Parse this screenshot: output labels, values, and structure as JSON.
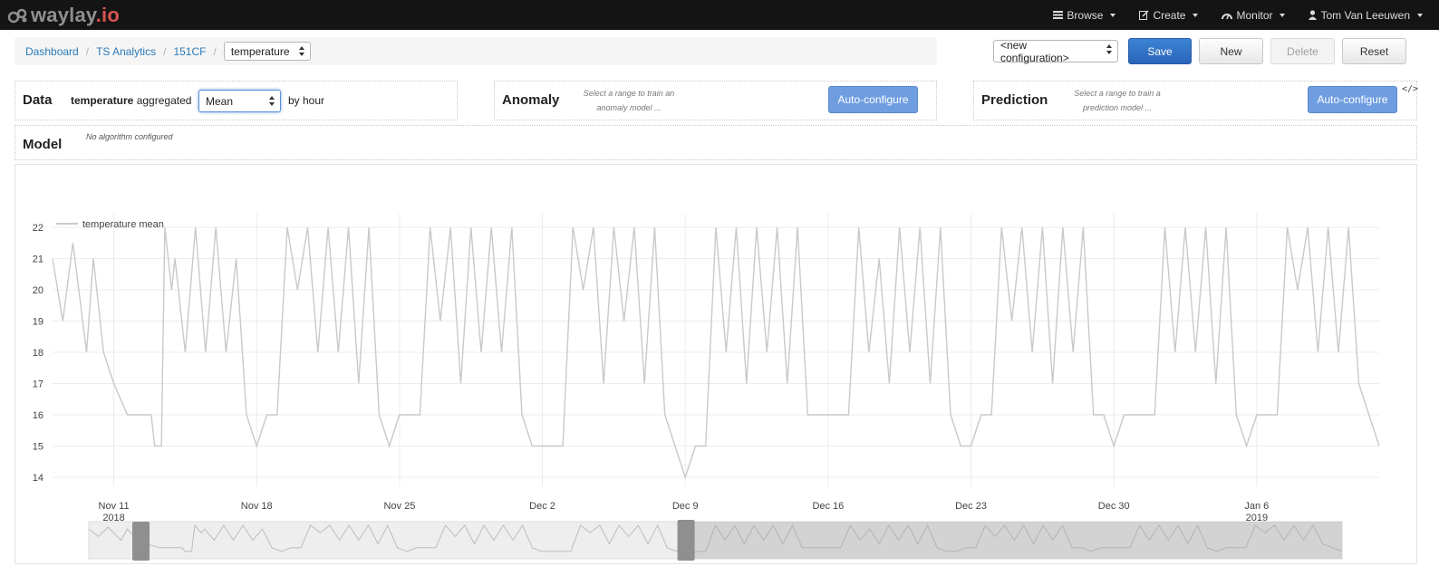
{
  "app": {
    "brand": "waylay",
    "brand_suffix": ".io",
    "nav": [
      {
        "label": "Browse",
        "icon": "list-icon"
      },
      {
        "label": "Create",
        "icon": "edit-icon"
      },
      {
        "label": "Monitor",
        "icon": "dashboard-icon"
      },
      {
        "label": "Tom Van Leeuwen",
        "icon": "user-icon"
      }
    ]
  },
  "breadcrumb": {
    "items": [
      "Dashboard",
      "TS Analytics",
      "151CF"
    ],
    "separator": "/",
    "metric_select": "temperature"
  },
  "toolbar": {
    "config_select": "<new configuration>",
    "save": "Save",
    "new": "New",
    "delete": "Delete",
    "reset": "Reset"
  },
  "data_panel": {
    "title": "Data",
    "metric": "temperature",
    "aggregated_label": "aggregated",
    "aggregation": "Mean",
    "interval": "by hour"
  },
  "anomaly_panel": {
    "title": "Anomaly",
    "hint_line1": "Select a range to train an",
    "hint_line2": "anomaly model ...",
    "button": "Auto-configure"
  },
  "prediction_panel": {
    "title": "Prediction",
    "hint_line1": "Select a range to train a",
    "hint_line2": "prediction model ...",
    "button": "Auto-configure"
  },
  "model_panel": {
    "title": "Model",
    "status": "No algorithm configured"
  },
  "colors": {
    "navbar": "#141414",
    "primary": "#2a64b8",
    "auto_button": "#6e9de0",
    "series": "#c9c9c9",
    "brand_accent": "#d9534f"
  },
  "chart_data": {
    "type": "line",
    "legend_position": "top-left",
    "grid": true,
    "ylim": [
      14,
      22
    ],
    "y_ticks": [
      14,
      15,
      16,
      17,
      18,
      19,
      20,
      21,
      22
    ],
    "x_range": [
      "2018-11-08",
      "2019-01-12"
    ],
    "x_ticks": [
      {
        "label": "Nov 11",
        "year": "2018",
        "date": "2018-11-11"
      },
      {
        "label": "Nov 18",
        "year": "",
        "date": "2018-11-18"
      },
      {
        "label": "Nov 25",
        "year": "",
        "date": "2018-11-25"
      },
      {
        "label": "Dec 2",
        "year": "",
        "date": "2018-12-02"
      },
      {
        "label": "Dec 9",
        "year": "",
        "date": "2018-12-09"
      },
      {
        "label": "Dec 16",
        "year": "",
        "date": "2018-12-16"
      },
      {
        "label": "Dec 23",
        "year": "",
        "date": "2018-12-23"
      },
      {
        "label": "Dec 30",
        "year": "",
        "date": "2018-12-30"
      },
      {
        "label": "Jan 6",
        "year": "2019",
        "date": "2019-01-06"
      }
    ],
    "series": [
      {
        "name": "temperature mean",
        "points": [
          [
            "2018-11-08",
            21
          ],
          [
            "2018-11-08T12",
            19
          ],
          [
            "2018-11-09",
            21.5
          ],
          [
            "2018-11-09T16",
            18
          ],
          [
            "2018-11-10",
            21
          ],
          [
            "2018-11-10T12",
            18
          ],
          [
            "2018-11-11",
            17
          ],
          [
            "2018-11-11T16",
            16
          ],
          [
            "2018-11-12",
            16
          ],
          [
            "2018-11-12T20",
            16
          ],
          [
            "2018-11-13",
            15
          ],
          [
            "2018-11-13T08",
            15
          ],
          [
            "2018-11-13T12",
            22
          ],
          [
            "2018-11-13T20",
            20
          ],
          [
            "2018-11-14",
            21
          ],
          [
            "2018-11-14T12",
            18
          ],
          [
            "2018-11-15",
            22
          ],
          [
            "2018-11-15T12",
            18
          ],
          [
            "2018-11-16",
            22
          ],
          [
            "2018-11-16T12",
            18
          ],
          [
            "2018-11-17",
            21
          ],
          [
            "2018-11-17T12",
            16
          ],
          [
            "2018-11-18",
            15
          ],
          [
            "2018-11-18T12",
            16
          ],
          [
            "2018-11-19",
            16
          ],
          [
            "2018-11-19T12",
            22
          ],
          [
            "2018-11-20",
            20
          ],
          [
            "2018-11-20T12",
            22
          ],
          [
            "2018-11-21",
            18
          ],
          [
            "2018-11-21T12",
            22
          ],
          [
            "2018-11-22",
            18
          ],
          [
            "2018-11-22T12",
            22
          ],
          [
            "2018-11-23",
            17
          ],
          [
            "2018-11-23T12",
            22
          ],
          [
            "2018-11-24",
            16
          ],
          [
            "2018-11-24T12",
            15
          ],
          [
            "2018-11-25",
            16
          ],
          [
            "2018-11-26",
            16
          ],
          [
            "2018-11-26T12",
            22
          ],
          [
            "2018-11-27",
            19
          ],
          [
            "2018-11-27T12",
            22
          ],
          [
            "2018-11-28",
            17
          ],
          [
            "2018-11-28T12",
            22
          ],
          [
            "2018-11-29",
            18
          ],
          [
            "2018-11-29T12",
            22
          ],
          [
            "2018-11-30",
            18
          ],
          [
            "2018-11-30T12",
            22
          ],
          [
            "2018-12-01",
            16
          ],
          [
            "2018-12-01T12",
            15
          ],
          [
            "2018-12-02",
            15
          ],
          [
            "2018-12-03",
            15
          ],
          [
            "2018-12-03T12",
            22
          ],
          [
            "2018-12-04",
            20
          ],
          [
            "2018-12-04T12",
            22
          ],
          [
            "2018-12-05",
            17
          ],
          [
            "2018-12-05T12",
            22
          ],
          [
            "2018-12-06",
            19
          ],
          [
            "2018-12-06T12",
            22
          ],
          [
            "2018-12-07",
            17
          ],
          [
            "2018-12-07T12",
            22
          ],
          [
            "2018-12-08",
            16
          ],
          [
            "2018-12-08T12",
            15
          ],
          [
            "2018-12-09",
            14
          ],
          [
            "2018-12-09T12",
            15
          ],
          [
            "2018-12-10",
            15
          ],
          [
            "2018-12-10T12",
            22
          ],
          [
            "2018-12-11",
            18
          ],
          [
            "2018-12-11T12",
            22
          ],
          [
            "2018-12-12",
            17
          ],
          [
            "2018-12-12T12",
            22
          ],
          [
            "2018-12-13",
            18
          ],
          [
            "2018-12-13T12",
            22
          ],
          [
            "2018-12-14",
            17
          ],
          [
            "2018-12-14T12",
            22
          ],
          [
            "2018-12-15",
            16
          ],
          [
            "2018-12-15T12",
            16
          ],
          [
            "2018-12-16",
            16
          ],
          [
            "2018-12-17",
            16
          ],
          [
            "2018-12-17T12",
            22
          ],
          [
            "2018-12-18",
            18
          ],
          [
            "2018-12-18T12",
            21
          ],
          [
            "2018-12-19",
            17
          ],
          [
            "2018-12-19T12",
            22
          ],
          [
            "2018-12-20",
            18
          ],
          [
            "2018-12-20T12",
            22
          ],
          [
            "2018-12-21",
            17
          ],
          [
            "2018-12-21T12",
            22
          ],
          [
            "2018-12-22",
            16
          ],
          [
            "2018-12-22T12",
            15
          ],
          [
            "2018-12-23",
            15
          ],
          [
            "2018-12-23T12",
            16
          ],
          [
            "2018-12-24",
            16
          ],
          [
            "2018-12-24T12",
            22
          ],
          [
            "2018-12-25",
            19
          ],
          [
            "2018-12-25T12",
            22
          ],
          [
            "2018-12-26",
            18
          ],
          [
            "2018-12-26T12",
            22
          ],
          [
            "2018-12-27",
            17
          ],
          [
            "2018-12-27T12",
            22
          ],
          [
            "2018-12-28",
            18
          ],
          [
            "2018-12-28T12",
            22
          ],
          [
            "2018-12-29",
            16
          ],
          [
            "2018-12-29T12",
            16
          ],
          [
            "2018-12-30",
            15
          ],
          [
            "2018-12-30T12",
            16
          ],
          [
            "2018-12-31",
            16
          ],
          [
            "2019-01-01",
            16
          ],
          [
            "2019-01-01T12",
            22
          ],
          [
            "2019-01-02",
            18
          ],
          [
            "2019-01-02T12",
            22
          ],
          [
            "2019-01-03",
            18
          ],
          [
            "2019-01-03T12",
            22
          ],
          [
            "2019-01-04",
            17
          ],
          [
            "2019-01-04T12",
            22
          ],
          [
            "2019-01-05",
            16
          ],
          [
            "2019-01-05T12",
            15
          ],
          [
            "2019-01-06",
            16
          ],
          [
            "2019-01-07",
            16
          ],
          [
            "2019-01-07T12",
            22
          ],
          [
            "2019-01-08",
            20
          ],
          [
            "2019-01-08T12",
            22
          ],
          [
            "2019-01-09",
            18
          ],
          [
            "2019-01-09T12",
            22
          ],
          [
            "2019-01-10",
            18
          ],
          [
            "2019-01-10T12",
            22
          ],
          [
            "2019-01-11",
            17
          ],
          [
            "2019-01-11T12",
            16
          ],
          [
            "2019-01-12",
            15
          ]
        ]
      }
    ],
    "navigator": {
      "selection_start": "2018-11-08",
      "selection_end": "2018-12-09"
    }
  }
}
